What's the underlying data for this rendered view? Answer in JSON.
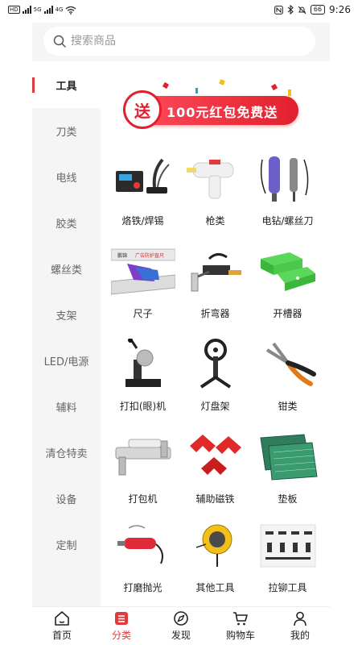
{
  "status_bar": {
    "left_tags": [
      "HD",
      "5G",
      "4G"
    ],
    "battery": "66",
    "time": "9:26"
  },
  "search": {
    "placeholder": "搜索商品",
    "icon": "search-icon"
  },
  "sidebar": {
    "items": [
      {
        "label": "工具",
        "active": true
      },
      {
        "label": "刀类",
        "active": false
      },
      {
        "label": "电线",
        "active": false
      },
      {
        "label": "胶类",
        "active": false
      },
      {
        "label": "螺丝类",
        "active": false
      },
      {
        "label": "支架",
        "active": false
      },
      {
        "label": "LED/电源",
        "active": false
      },
      {
        "label": "辅料",
        "active": false
      },
      {
        "label": "清仓特卖",
        "active": false
      },
      {
        "label": "设备",
        "active": false
      },
      {
        "label": "定制",
        "active": false
      }
    ]
  },
  "banner": {
    "badge": "送",
    "text": "100元红包免费送",
    "color": "#e1202e"
  },
  "products": [
    {
      "label": "烙铁/焊锡",
      "icon": "soldering-iron-icon"
    },
    {
      "label": "枪类",
      "icon": "glue-gun-icon"
    },
    {
      "label": "电钻/螺丝刀",
      "icon": "electric-drill-icon"
    },
    {
      "label": "尺子",
      "icon": "ruler-icon"
    },
    {
      "label": "折弯器",
      "icon": "bender-icon"
    },
    {
      "label": "开槽器",
      "icon": "slotter-icon"
    },
    {
      "label": "打扣(眼)机",
      "icon": "eyelet-machine-icon"
    },
    {
      "label": "灯盘架",
      "icon": "lamp-tray-stand-icon"
    },
    {
      "label": "钳类",
      "icon": "pliers-icon"
    },
    {
      "label": "打包机",
      "icon": "packing-machine-icon"
    },
    {
      "label": "辅助磁铁",
      "icon": "magnet-icon"
    },
    {
      "label": "垫板",
      "icon": "cutting-mat-icon"
    },
    {
      "label": "打磨抛光",
      "icon": "grinder-icon"
    },
    {
      "label": "其他工具",
      "icon": "tape-measure-icon"
    },
    {
      "label": "拉铆工具",
      "icon": "rivet-tool-icon"
    }
  ],
  "ruler_print": {
    "brand": "鹏锦",
    "text": "广告防护直尺"
  },
  "tabbar": {
    "items": [
      {
        "label": "首页",
        "icon": "home-icon",
        "active": false
      },
      {
        "label": "分类",
        "icon": "category-icon",
        "active": true
      },
      {
        "label": "发现",
        "icon": "discover-icon",
        "active": false
      },
      {
        "label": "购物车",
        "icon": "cart-icon",
        "active": false
      },
      {
        "label": "我的",
        "icon": "profile-icon",
        "active": false
      }
    ]
  },
  "colors": {
    "accent": "#e23a3a",
    "sidebar_bg": "#f5f5f5",
    "page_bg": "#ffffff"
  }
}
